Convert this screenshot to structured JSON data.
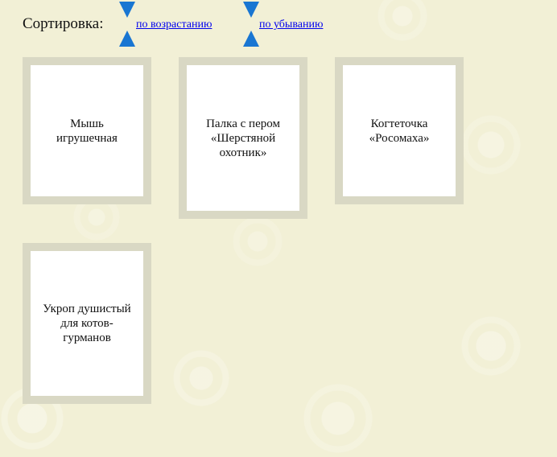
{
  "sort": {
    "label": "Сортировка:",
    "ascending": "по возрастанию",
    "descending": "по убыванию",
    "arrow_color": "#1976d2"
  },
  "products": [
    {
      "title": "Мышь игрушечная"
    },
    {
      "title": "Палка с пером «Шерстяной охотник»"
    },
    {
      "title": "Когтеточка «Росомаха»"
    },
    {
      "title": "Укроп душистый для котов-гурманов"
    }
  ]
}
